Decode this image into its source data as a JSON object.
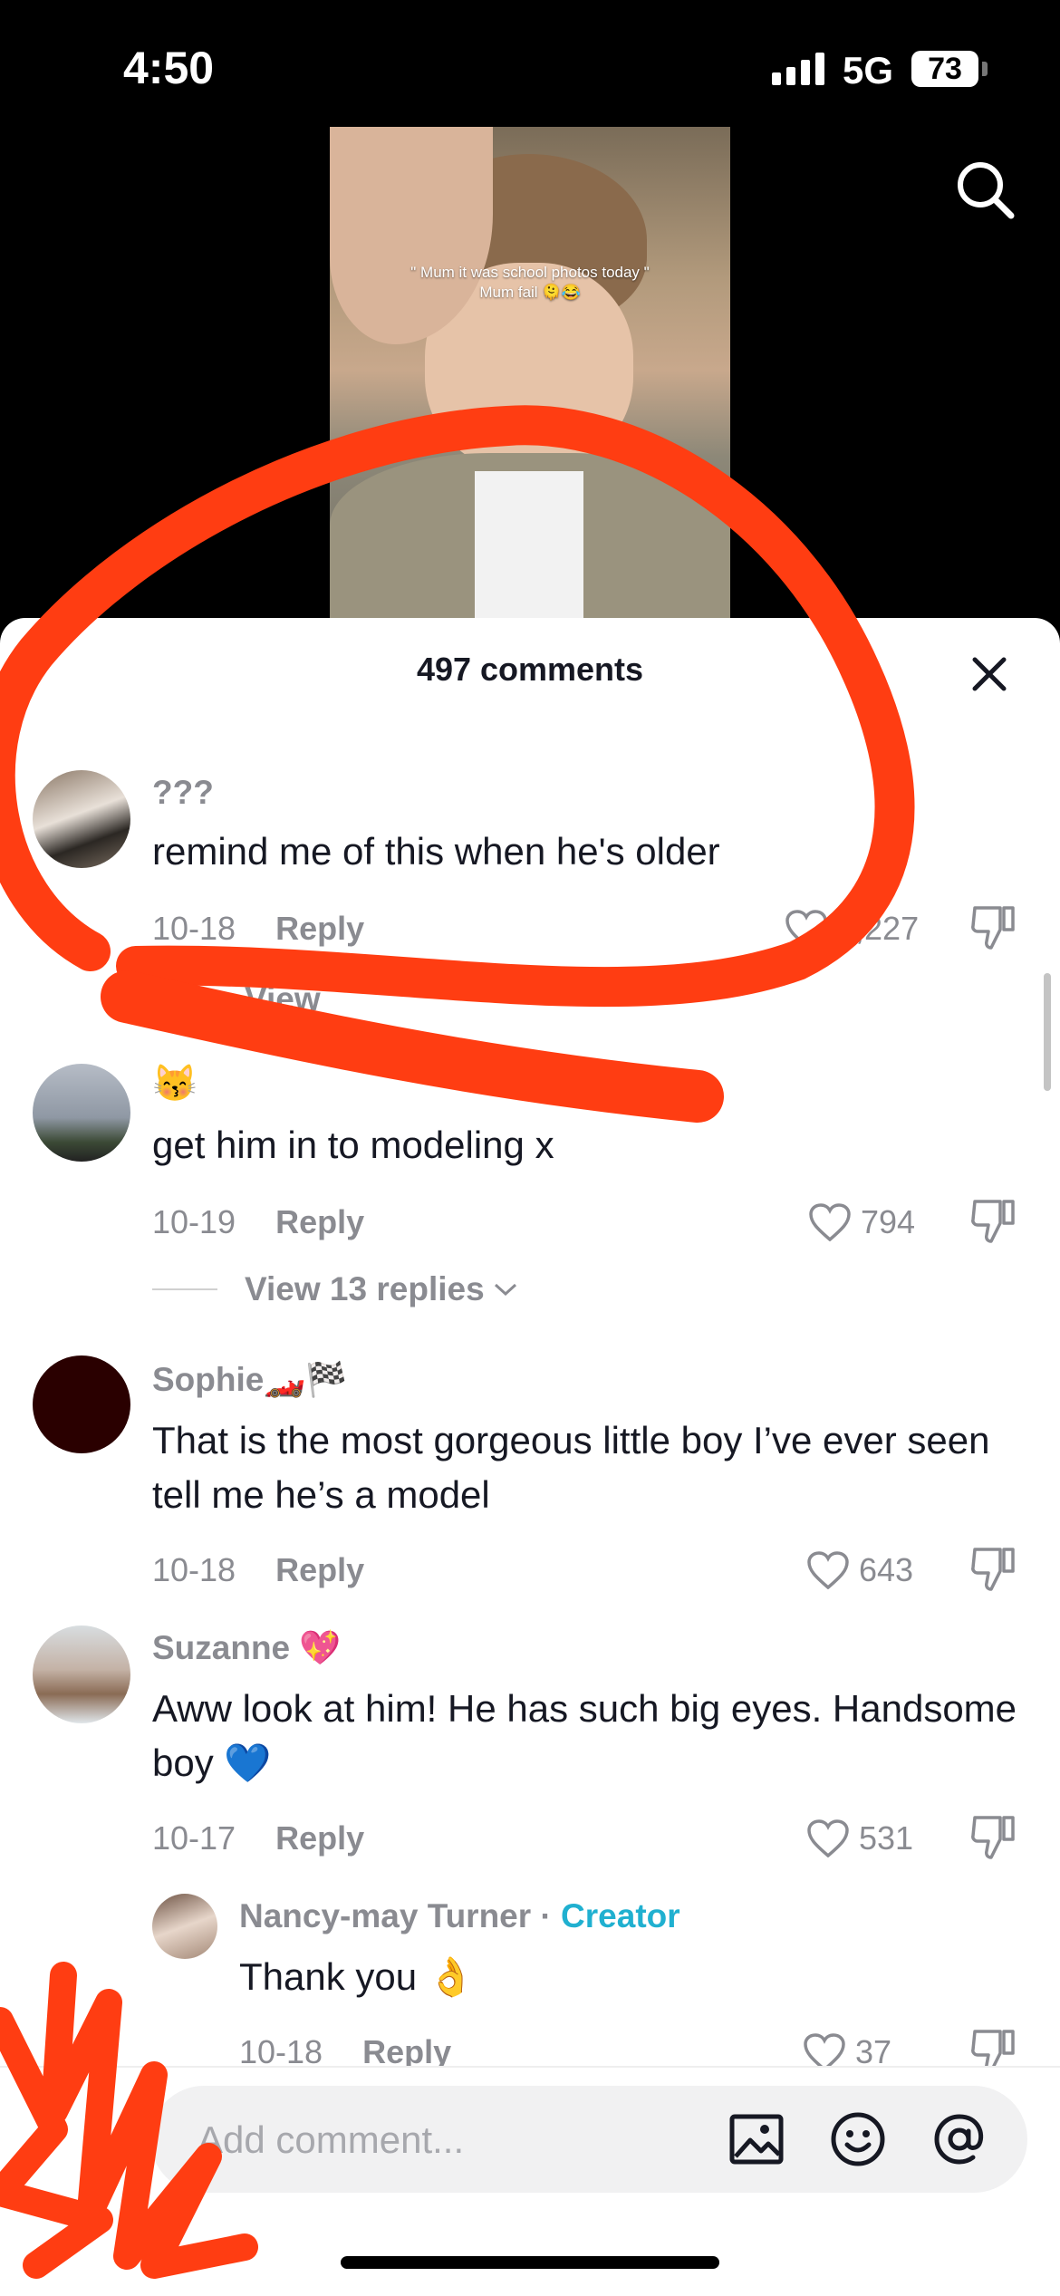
{
  "status_bar": {
    "time": "4:50",
    "network": "5G",
    "battery": "73"
  },
  "video": {
    "caption_line1": "\" Mum it was school photos today \"",
    "caption_line2": "Mum fail 🫠😂"
  },
  "sheet": {
    "title": "497 comments"
  },
  "comments": [
    {
      "username": "???",
      "text": "remind me of this when he's older",
      "date": "10-18",
      "reply_label": "Reply",
      "likes": "1,227",
      "view_replies": "View"
    },
    {
      "username": "😽",
      "text": "get him in to modeling x",
      "date": "10-19",
      "reply_label": "Reply",
      "likes": "794",
      "view_replies": "View 13 replies"
    },
    {
      "username": "Sophie🏎️🏁",
      "text": "That is the most gorgeous little boy I’ve ever seen tell me he’s a model",
      "date": "10-18",
      "reply_label": "Reply",
      "likes": "643"
    },
    {
      "username": "Suzanne 💖",
      "text": "Aww look at him! He has such big eyes. Handsome boy 💙",
      "date": "10-17",
      "reply_label": "Reply",
      "likes": "531"
    },
    {
      "username": "Nancy-may Turner",
      "creator_label": "Creator",
      "separator": " · ",
      "text": "Thank you 👌",
      "date": "10-18",
      "reply_label": "Reply",
      "likes": "37"
    }
  ],
  "composer": {
    "placeholder": "Add comment..."
  },
  "colors": {
    "annotation": "#ff3d12",
    "creator": "#20b0d0",
    "muted": "#8a8b91"
  }
}
